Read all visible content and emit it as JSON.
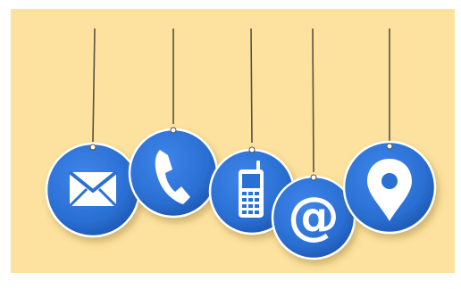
{
  "scene": {
    "description": "",
    "background_color": "#fce29e",
    "tag_color": "#2a6fd3",
    "tag_rim_color": "#ffffff",
    "icon_color": "#ffffff",
    "string_color": "#5a5040"
  },
  "tags": [
    {
      "icon": "envelope-icon"
    },
    {
      "icon": "phone-handset-icon"
    },
    {
      "icon": "mobile-phone-icon"
    },
    {
      "icon": "at-sign-icon",
      "glyph": "@"
    },
    {
      "icon": "location-pin-icon"
    }
  ]
}
